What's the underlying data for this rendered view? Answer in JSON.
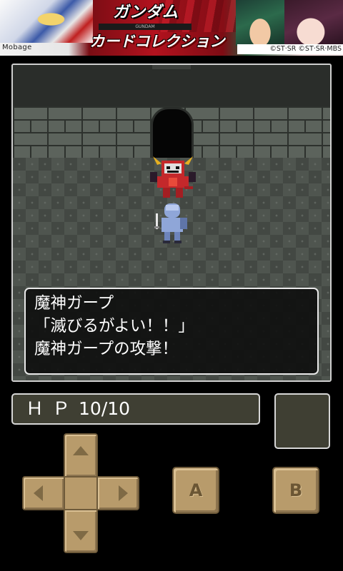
{
  "banner": {
    "brand": "Mobage",
    "logo_top": "ガンダム",
    "logo_bar": "GUNDAM",
    "logo_bottom": "カードコレクション",
    "copyright": "©ST·SR ©ST·SR·MBS"
  },
  "message": {
    "line1": "魔神ガープ",
    "line2": "「滅びるがよい！！」",
    "line3": "魔神ガープの攻撃！"
  },
  "hud": {
    "hp_label": "ＨＰ",
    "hp_value": "10/10"
  },
  "controls": {
    "a_label": "A",
    "b_label": "B"
  },
  "icons": {
    "dpad_up": "arrow-up-icon",
    "dpad_down": "arrow-down-icon",
    "dpad_left": "arrow-left-icon",
    "dpad_right": "arrow-right-icon"
  },
  "colors": {
    "button_face": "#b89b6b",
    "hud_bg": "#3f3f33",
    "demon_red": "#c4282b",
    "knight_blue": "#8fa6d8"
  }
}
